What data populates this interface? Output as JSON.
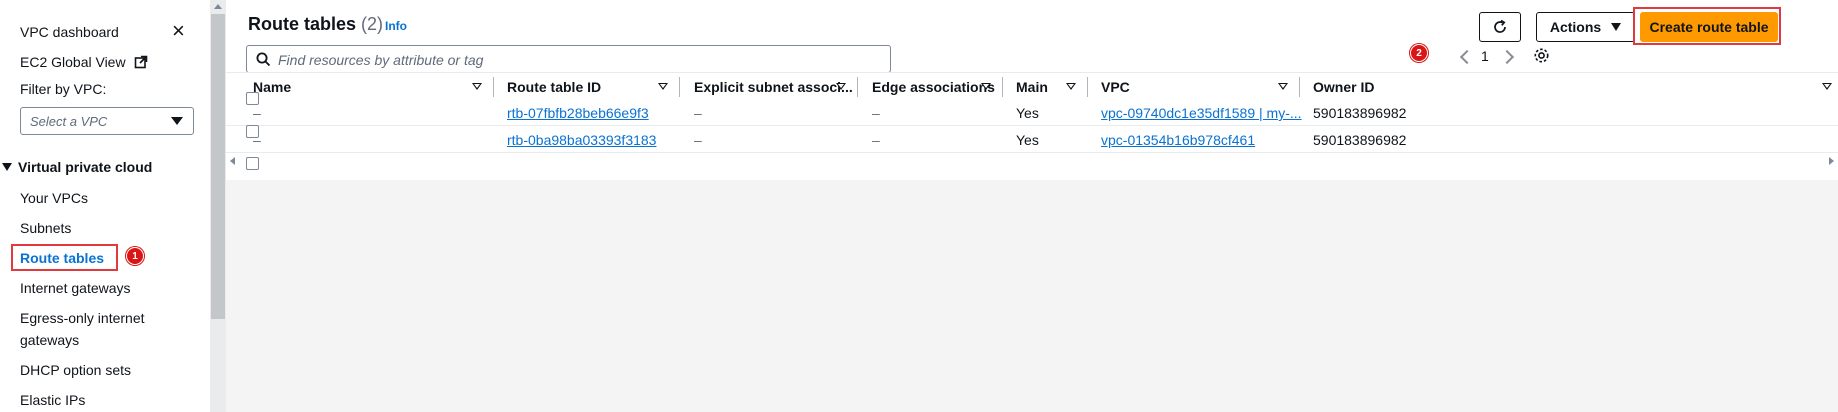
{
  "sidebar": {
    "vpc_dashboard": "VPC dashboard",
    "ec2_global_view": "EC2 Global View",
    "filter_label": "Filter by VPC:",
    "filter_placeholder": "Select a VPC",
    "section_title": "Virtual private cloud",
    "items": [
      "Your VPCs",
      "Subnets",
      "Route tables",
      "Internet gateways",
      "Egress-only internet",
      "gateways",
      "DHCP option sets",
      "Elastic IPs"
    ],
    "active_index": 2,
    "badge_1": "1"
  },
  "header": {
    "title": "Route tables",
    "count": "(2)",
    "info": "Info",
    "search_placeholder": "Find resources by attribute or tag",
    "actions_label": "Actions",
    "create_label": "Create route table",
    "badge_2": "2",
    "page_number": "1"
  },
  "table": {
    "columns": [
      "Name",
      "Route table ID",
      "Explicit subnet associ...",
      "Edge associations",
      "Main",
      "VPC",
      "Owner ID"
    ],
    "rows": [
      {
        "name": "–",
        "route_table_id": "rtb-07fbfb28beb66e9f3",
        "explicit": "–",
        "edge": "–",
        "main": "Yes",
        "vpc": "vpc-09740dc1e35df1589 | my-...",
        "owner": "590183896982"
      },
      {
        "name": "–",
        "route_table_id": "rtb-0ba98ba03393f3183",
        "explicit": "–",
        "edge": "–",
        "main": "Yes",
        "vpc": "vpc-01354b16b978cf461",
        "owner": "590183896982"
      }
    ]
  },
  "colors": {
    "accent_orange": "#ff9900",
    "link_blue": "#0972d3",
    "highlight_red": "#e0393e",
    "badge_red": "#d91515"
  }
}
